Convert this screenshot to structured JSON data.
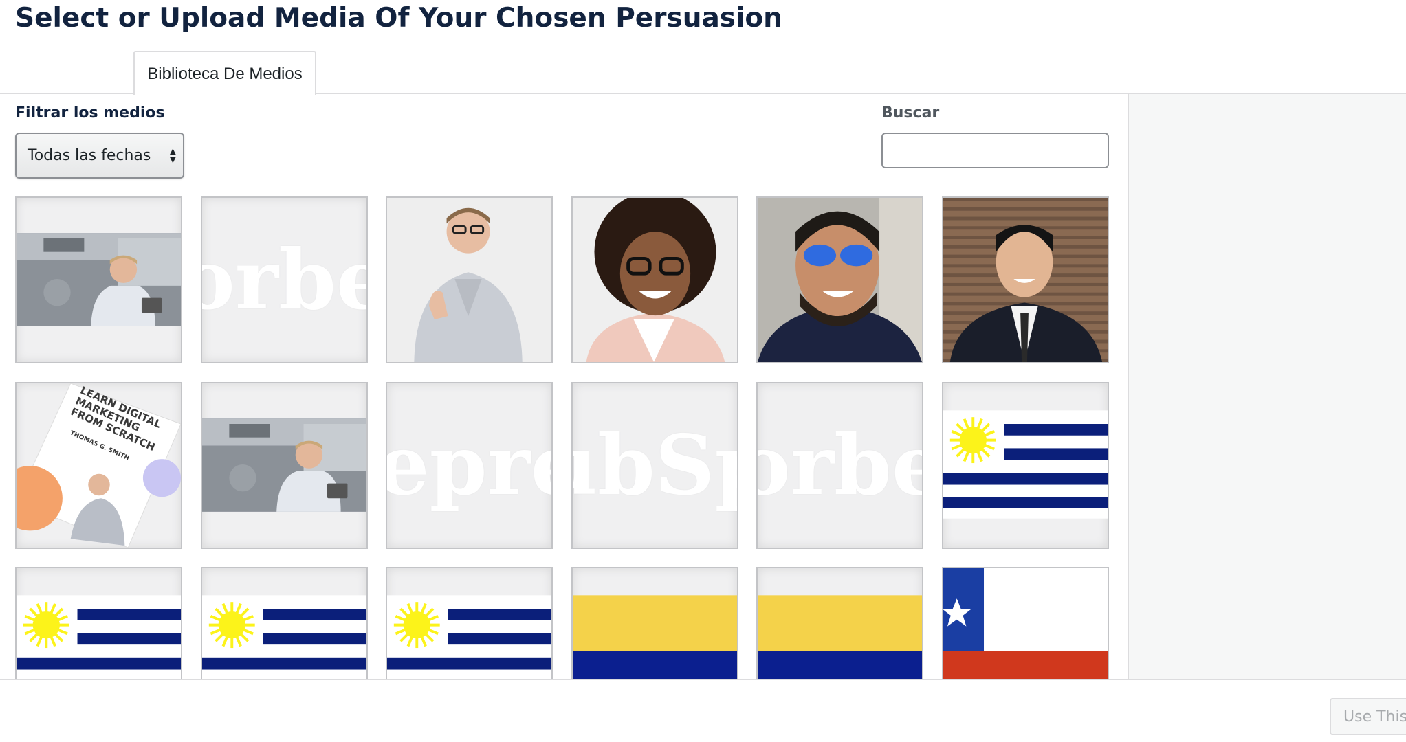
{
  "modal": {
    "title": "Select or Upload Media Of Your Chosen Persuasion"
  },
  "tabs": [
    {
      "label": "Biblioteca De Medios"
    }
  ],
  "filter": {
    "label": "Filtrar los medios",
    "selected": "Todas las fechas"
  },
  "search": {
    "label": "Buscar",
    "value": "",
    "placeholder": ""
  },
  "media_grid": {
    "rows": [
      [
        {
          "kind": "photo-man-tablet"
        },
        {
          "kind": "logo",
          "text": "orbe"
        },
        {
          "kind": "photo-man-thumbsup"
        },
        {
          "kind": "photo-woman-glasses"
        },
        {
          "kind": "photo-man-sunglasses"
        },
        {
          "kind": "photo-man-suit"
        }
      ],
      [
        {
          "kind": "ebook-cover",
          "cover_title": "LEARN DIGITAL MARKETING FROM SCRATCH",
          "author": "THOMAS G. SMITH"
        },
        {
          "kind": "photo-man-tablet"
        },
        {
          "kind": "logo",
          "text": "trepren"
        },
        {
          "kind": "logo",
          "text": "ubSp"
        },
        {
          "kind": "logo",
          "text": "orbe"
        },
        {
          "kind": "flag-uruguay"
        }
      ],
      [
        {
          "kind": "flag-uruguay"
        },
        {
          "kind": "flag-uruguay"
        },
        {
          "kind": "flag-uruguay"
        },
        {
          "kind": "flag-colombia"
        },
        {
          "kind": "flag-colombia"
        },
        {
          "kind": "flag-chile"
        }
      ]
    ]
  },
  "colors": {
    "title": "#12233f",
    "flag_blue": "#0b1f7a",
    "flag_yellow": "#f4d24a",
    "sun_yellow": "#fcf31a",
    "chile_red": "#d0381d",
    "chile_blue": "#1a3ea3"
  },
  "footer": {
    "use_button_label": "Use This"
  }
}
